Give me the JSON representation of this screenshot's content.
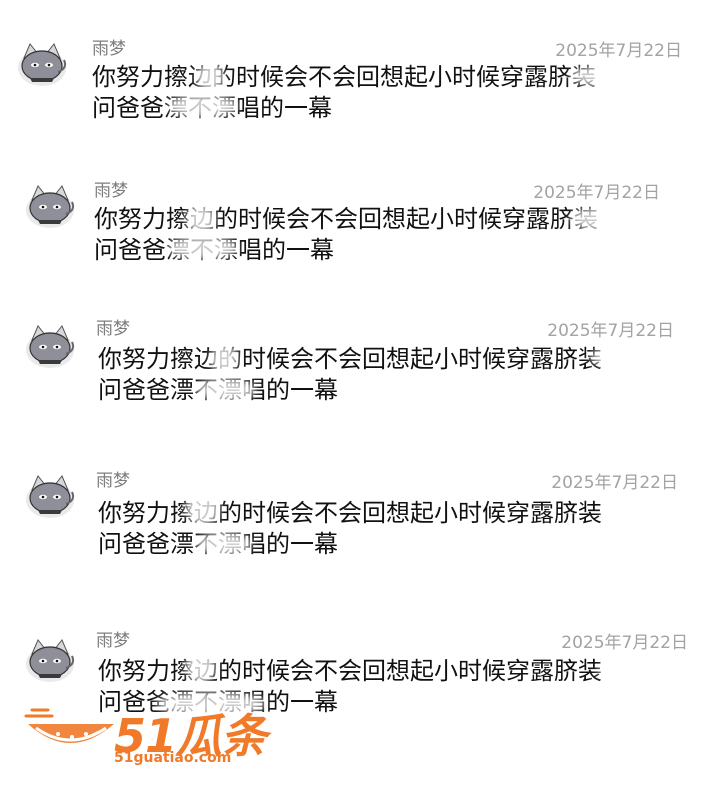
{
  "comments": [
    {
      "username": "雨梦",
      "date": "2025年7月22日",
      "line1": "你努力擦边的时候会不会回想起小时候穿露脐装",
      "line2": "问爸爸漂不漂唱的一幕"
    },
    {
      "username": "雨梦",
      "date": "2025年7月22日",
      "line1": "你努力擦边的时候会不会回想起小时候穿露脐装",
      "line2": "问爸爸漂不漂唱的一幕"
    },
    {
      "username": "雨梦",
      "date": "2025年7月22日",
      "line1": "你努力擦边的时候会不会回想起小时候穿露脐装",
      "line2": "问爸爸漂不漂唱的一幕"
    },
    {
      "username": "雨梦",
      "date": "2025年7月22日",
      "line1": "你努力擦边的时候会不会回想起小时候穿露脐装",
      "line2": "问爸爸漂不漂唱的一幕"
    },
    {
      "username": "雨梦",
      "date": "2025年7月22日",
      "line1": "你努力擦边的时候会不会回想起小时候穿露脐装",
      "line2": "问爸爸漂不漂唱的一幕"
    }
  ],
  "watermark": {
    "brand": "51瓜条",
    "domain": "51guatiao.com",
    "color": "#f07a2a"
  },
  "colors": {
    "username": "#7d7d7d",
    "date": "#a3a3a3",
    "text": "#111111",
    "background": "#ffffff"
  },
  "icons": {
    "avatar": "grey-cat-avatar-icon",
    "watermark_logo": "watermelon-slice-icon"
  }
}
